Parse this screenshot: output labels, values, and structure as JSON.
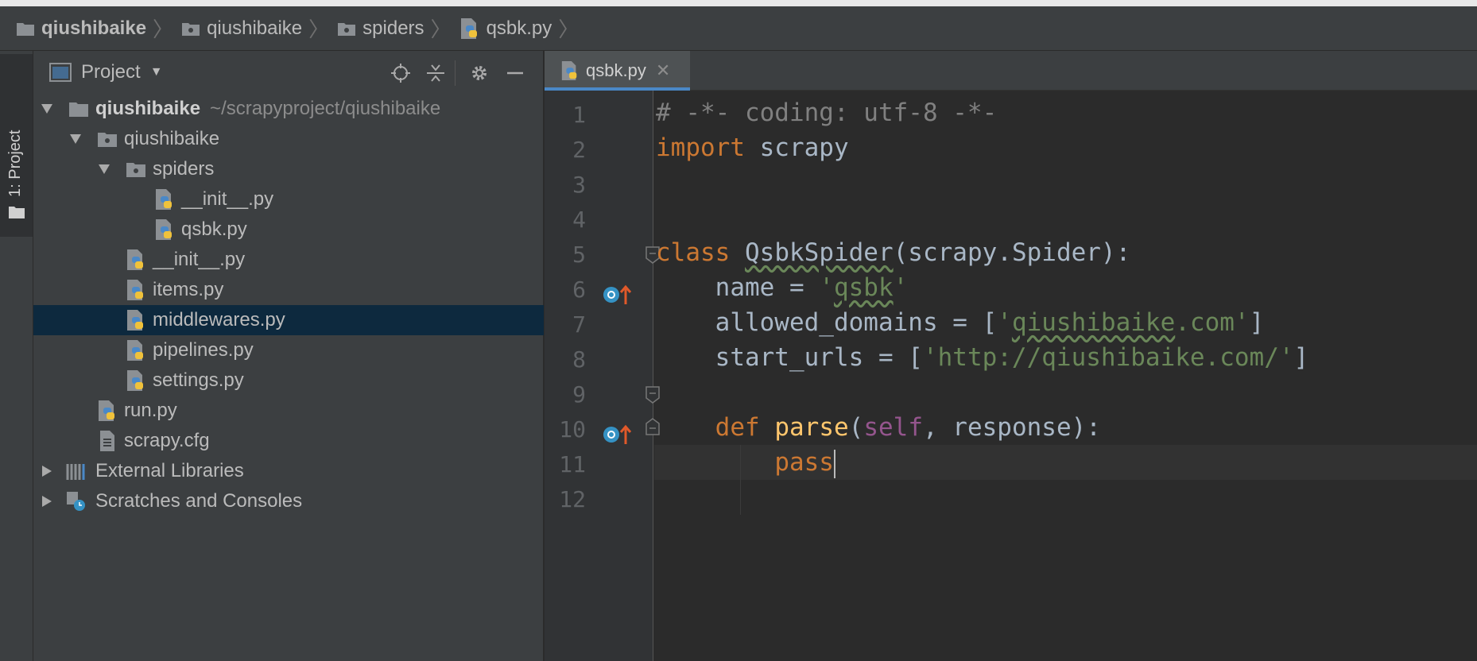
{
  "breadcrumb": {
    "items": [
      {
        "label": "qiushibaike",
        "icon": "folder-icon"
      },
      {
        "label": "qiushibaike",
        "icon": "package-folder-icon"
      },
      {
        "label": "spiders",
        "icon": "package-folder-icon"
      },
      {
        "label": "qsbk.py",
        "icon": "python-file-icon"
      }
    ]
  },
  "tool_window": {
    "tab_label": "1: Project"
  },
  "project_panel": {
    "title": "Project",
    "tree": [
      {
        "label": "qiushibaike",
        "path": "~/scrapyproject/qiushibaike",
        "depth": 0,
        "expanded": true,
        "icon": "folder-icon"
      },
      {
        "label": "qiushibaike",
        "depth": 1,
        "expanded": true,
        "icon": "package-folder-icon"
      },
      {
        "label": "spiders",
        "depth": 2,
        "expanded": true,
        "icon": "package-folder-icon"
      },
      {
        "label": "__init__.py",
        "depth": 3,
        "icon": "python-file-icon"
      },
      {
        "label": "qsbk.py",
        "depth": 3,
        "icon": "python-file-icon"
      },
      {
        "label": "__init__.py",
        "depth": 2,
        "icon": "python-file-icon"
      },
      {
        "label": "items.py",
        "depth": 2,
        "icon": "python-file-icon"
      },
      {
        "label": "middlewares.py",
        "depth": 2,
        "icon": "python-file-icon",
        "selected": true
      },
      {
        "label": "pipelines.py",
        "depth": 2,
        "icon": "python-file-icon"
      },
      {
        "label": "settings.py",
        "depth": 2,
        "icon": "python-file-icon"
      },
      {
        "label": "run.py",
        "depth": 1,
        "icon": "python-file-icon"
      },
      {
        "label": "scrapy.cfg",
        "depth": 1,
        "icon": "text-file-icon"
      },
      {
        "label": "External Libraries",
        "depth": 0,
        "expanded": false,
        "icon": "library-icon"
      },
      {
        "label": "Scratches and Consoles",
        "depth": 0,
        "expanded": false,
        "icon": "scratches-icon"
      }
    ]
  },
  "editor": {
    "tab_label": "qsbk.py",
    "line_numbers": [
      "1",
      "2",
      "3",
      "4",
      "5",
      "6",
      "7",
      "8",
      "9",
      "10",
      "11",
      "12"
    ],
    "current_line": 11,
    "code": {
      "l1": "# -*- coding: utf-8 -*-",
      "l2_kw": "import",
      "l2_rest": " scrapy",
      "l5_kw": "class",
      "l5_sp": " ",
      "l5_name": "QsbkSpider",
      "l5_rest": "(scrapy.Spider):",
      "l6_a": "    name = ",
      "l6_q1": "'",
      "l6_s": "qsbk",
      "l6_q2": "'",
      "l7_a": "    allowed_domains = [",
      "l7_q1": "'",
      "l7_s1": "qiushibaike",
      "l7_s2": ".com'",
      "l7_b": "]",
      "l8_a": "    start_urls = [",
      "l8_s": "'http://qiushibaike.com/'",
      "l8_b": "]",
      "l10_ind": "    ",
      "l10_kw": "def",
      "l10_sp": " ",
      "l10_fn": "parse",
      "l10_p": "(",
      "l10_self": "self",
      "l10_rest": ", response):",
      "l11_ind": "        ",
      "l11_kw": "pass"
    }
  },
  "colors": {
    "editor_bg": "#2b2b2b",
    "panel_bg": "#3c3f41",
    "selection": "#0d293e",
    "keyword": "#cc7832",
    "string": "#6a8759",
    "function": "#ffc66d",
    "self": "#94558d",
    "comment": "#808080",
    "accent": "#4a88c7"
  }
}
